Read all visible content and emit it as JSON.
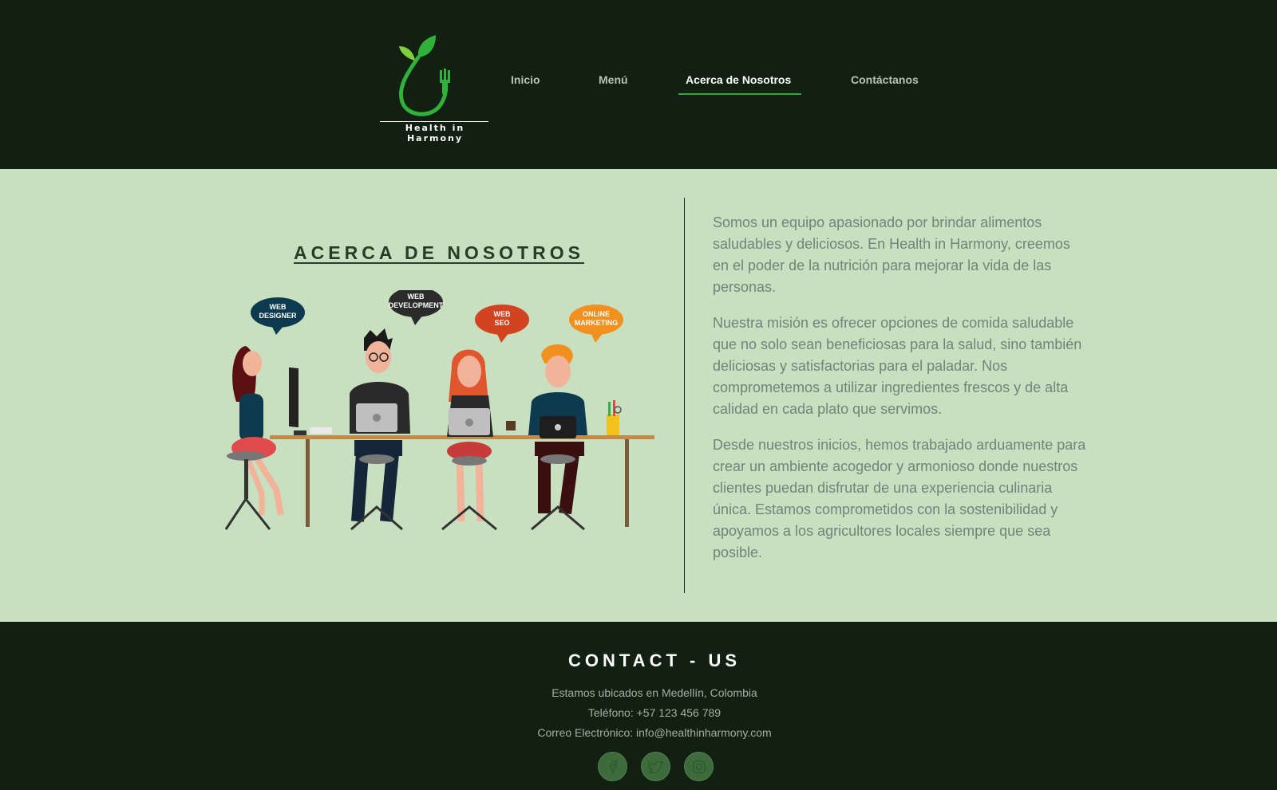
{
  "brand": {
    "name": "Health in Harmony"
  },
  "nav": {
    "items": [
      {
        "label": "Inicio"
      },
      {
        "label": "Menú"
      },
      {
        "label": "Acerca de Nosotros",
        "active": true
      },
      {
        "label": "Contáctanos"
      }
    ]
  },
  "about": {
    "title": "ACERCA DE NOSOTROS",
    "illustration_bubbles": [
      "WEB DESIGNER",
      "WEB DEVELOPMENT",
      "WEB SEO",
      "ONLINE MARKETING"
    ],
    "paragraphs": [
      "Somos un equipo apasionado por brindar alimentos saludables y deliciosos. En Health in Harmony, creemos en el poder de la nutrición para mejorar la vida de las personas.",
      "Nuestra misión es ofrecer opciones de comida saludable que no solo sean beneficiosas para la salud, sino también deliciosas y satisfactorias para el paladar. Nos comprometemos a utilizar ingredientes frescos y de alta calidad en cada plato que servimos.",
      "Desde nuestros inicios, hemos trabajado arduamente para crear un ambiente acogedor y armonioso donde nuestros clientes puedan disfrutar de una experiencia culinaria única. Estamos comprometidos con la sostenibilidad y apoyamos a los agricultores locales siempre que sea posible."
    ]
  },
  "footer": {
    "title": "CONTACT - US",
    "location": "Estamos ubicados en Medellín, Colombia",
    "phone": "Teléfono: +57 123 456 789",
    "email": "Correo Electrónico: info@healthinharmony.com",
    "social": [
      {
        "icon": "facebook-icon"
      },
      {
        "icon": "twitter-icon"
      },
      {
        "icon": "instagram-icon"
      }
    ]
  },
  "colors": {
    "header_bg": "#112011",
    "main_bg": "#c8dfc0",
    "accent": "#2da83a"
  }
}
